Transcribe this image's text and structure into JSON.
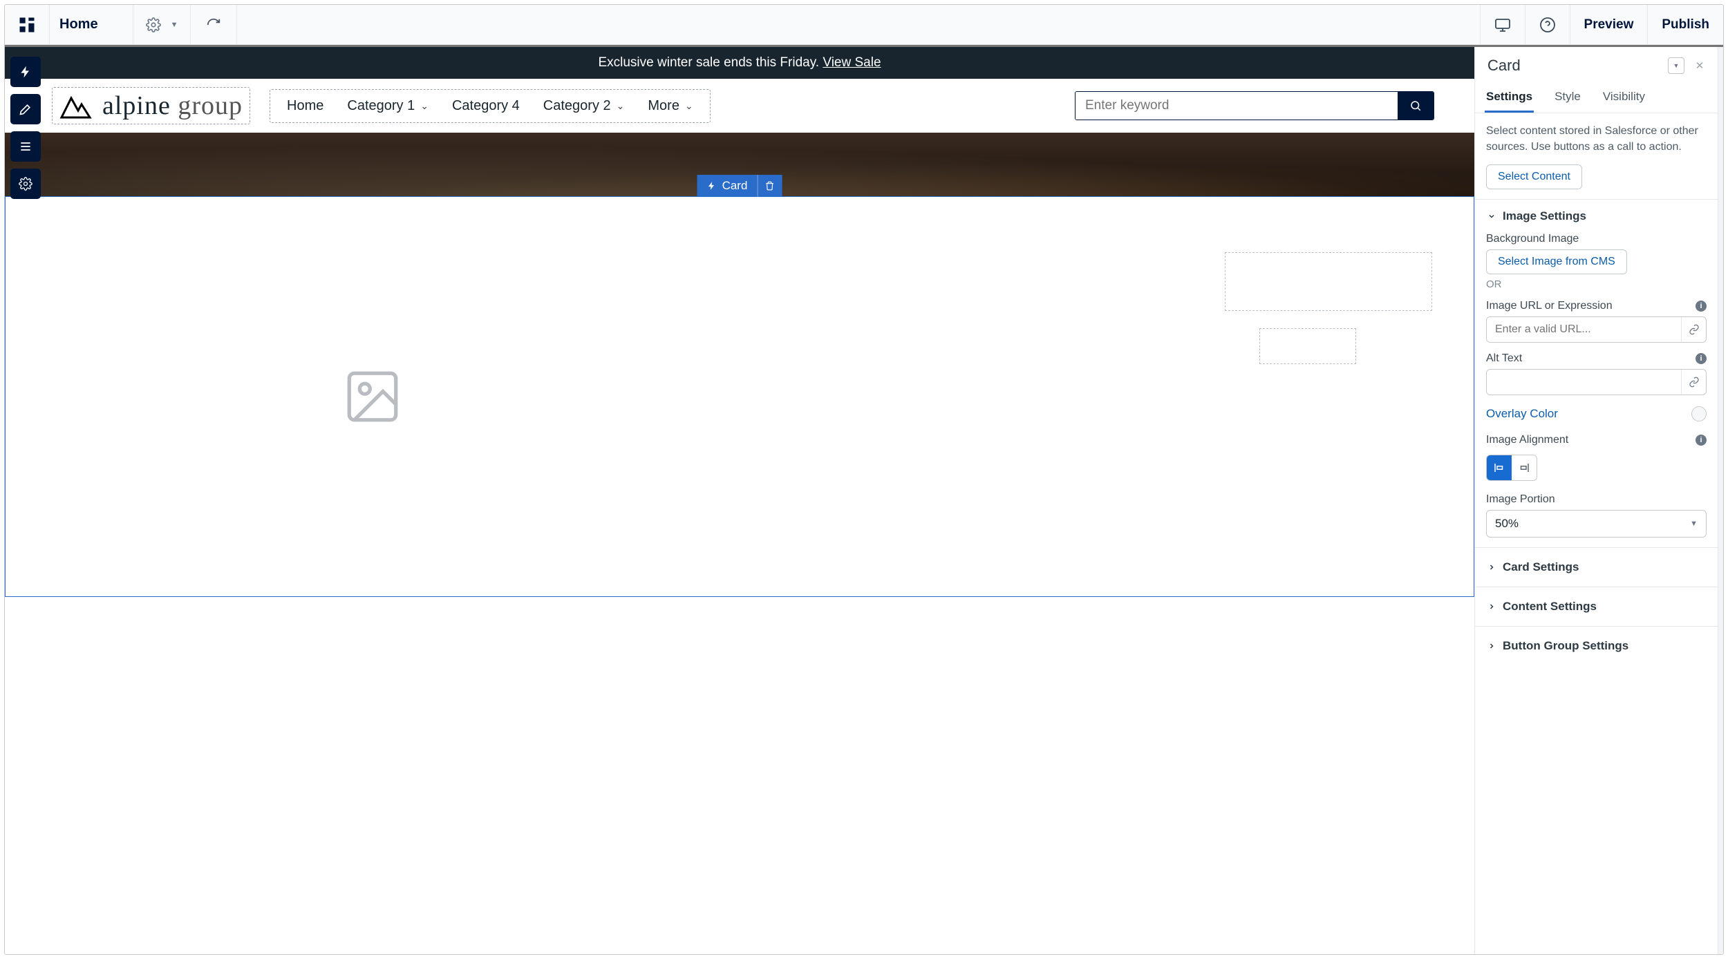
{
  "topbar": {
    "page_label": "Home",
    "preview_label": "Preview",
    "publish_label": "Publish"
  },
  "preview_site": {
    "banner_text": "Exclusive winter sale ends this Friday. ",
    "banner_link_text": "View Sale",
    "brand_main": "alpine",
    "brand_sub": "group",
    "nav": {
      "home": "Home",
      "cat1": "Category 1",
      "cat4": "Category 4",
      "cat2": "Category 2",
      "more": "More"
    },
    "search_placeholder": "Enter keyword"
  },
  "selected_component": {
    "label": "Card"
  },
  "panel": {
    "title": "Card",
    "tabs": {
      "settings": "Settings",
      "style": "Style",
      "visibility": "Visibility"
    },
    "content_helper": "Select content stored in Salesforce or other sources. Use buttons as a call to action.",
    "select_content_btn": "Select Content",
    "image_settings": {
      "heading": "Image Settings",
      "bg_label": "Background Image",
      "select_from_cms_btn": "Select Image from CMS",
      "or": "OR",
      "url_label": "Image URL or Expression",
      "url_placeholder": "Enter a valid URL...",
      "alt_label": "Alt Text",
      "overlay_label": "Overlay Color",
      "alignment_label": "Image Alignment",
      "portion_label": "Image Portion",
      "portion_value": "50%"
    },
    "card_settings_heading": "Card Settings",
    "content_settings_heading": "Content Settings",
    "button_group_settings_heading": "Button Group Settings"
  }
}
